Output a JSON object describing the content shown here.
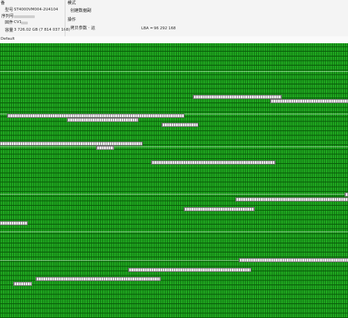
{
  "device": {
    "section_label": "备",
    "model_label": "型号",
    "model_value": "ST4000VM004-2U4104",
    "serial_label": "序列号",
    "interface_label": "固件",
    "interface_value": "CV1",
    "capacity_label": "容量",
    "capacity_value": "3 726.02 GB (7 814 037 168)"
  },
  "mode": {
    "section_label": "模式",
    "option_label": "创建数据副"
  },
  "operation": {
    "section_label": "操作",
    "copy_params_label": "拷贝参数 · 运",
    "lba_label": "LBA =",
    "lba_value": "96 292 168"
  },
  "default_label": "Default",
  "colors": {
    "good_sector": "#20a820",
    "bad_sector": "#efefef"
  },
  "sector_map": {
    "bad_runs": [
      {
        "row": 11,
        "start": 0.556,
        "end": 0.808
      },
      {
        "row": 12,
        "start": 0.778,
        "end": 1.0
      },
      {
        "row": 15,
        "start": 0.022,
        "end": 0.528
      },
      {
        "row": 16,
        "start": 0.194,
        "end": 0.396
      },
      {
        "row": 17,
        "start": 0.466,
        "end": 0.568
      },
      {
        "row": 21,
        "start": 0.0,
        "end": 0.408
      },
      {
        "row": 22,
        "start": 0.278,
        "end": 0.326
      },
      {
        "row": 25,
        "start": 0.436,
        "end": 0.79
      },
      {
        "row": 32,
        "start": 0.992,
        "end": 1.0
      },
      {
        "row": 33,
        "start": 0.678,
        "end": 1.0
      },
      {
        "row": 35,
        "start": 0.53,
        "end": 0.73
      },
      {
        "row": 38,
        "start": 0.0,
        "end": 0.078
      },
      {
        "row": 46,
        "start": 0.688,
        "end": 1.0
      },
      {
        "row": 48,
        "start": 0.37,
        "end": 0.72
      },
      {
        "row": 50,
        "start": 0.104,
        "end": 0.46
      },
      {
        "row": 51,
        "start": 0.04,
        "end": 0.09
      }
    ]
  }
}
